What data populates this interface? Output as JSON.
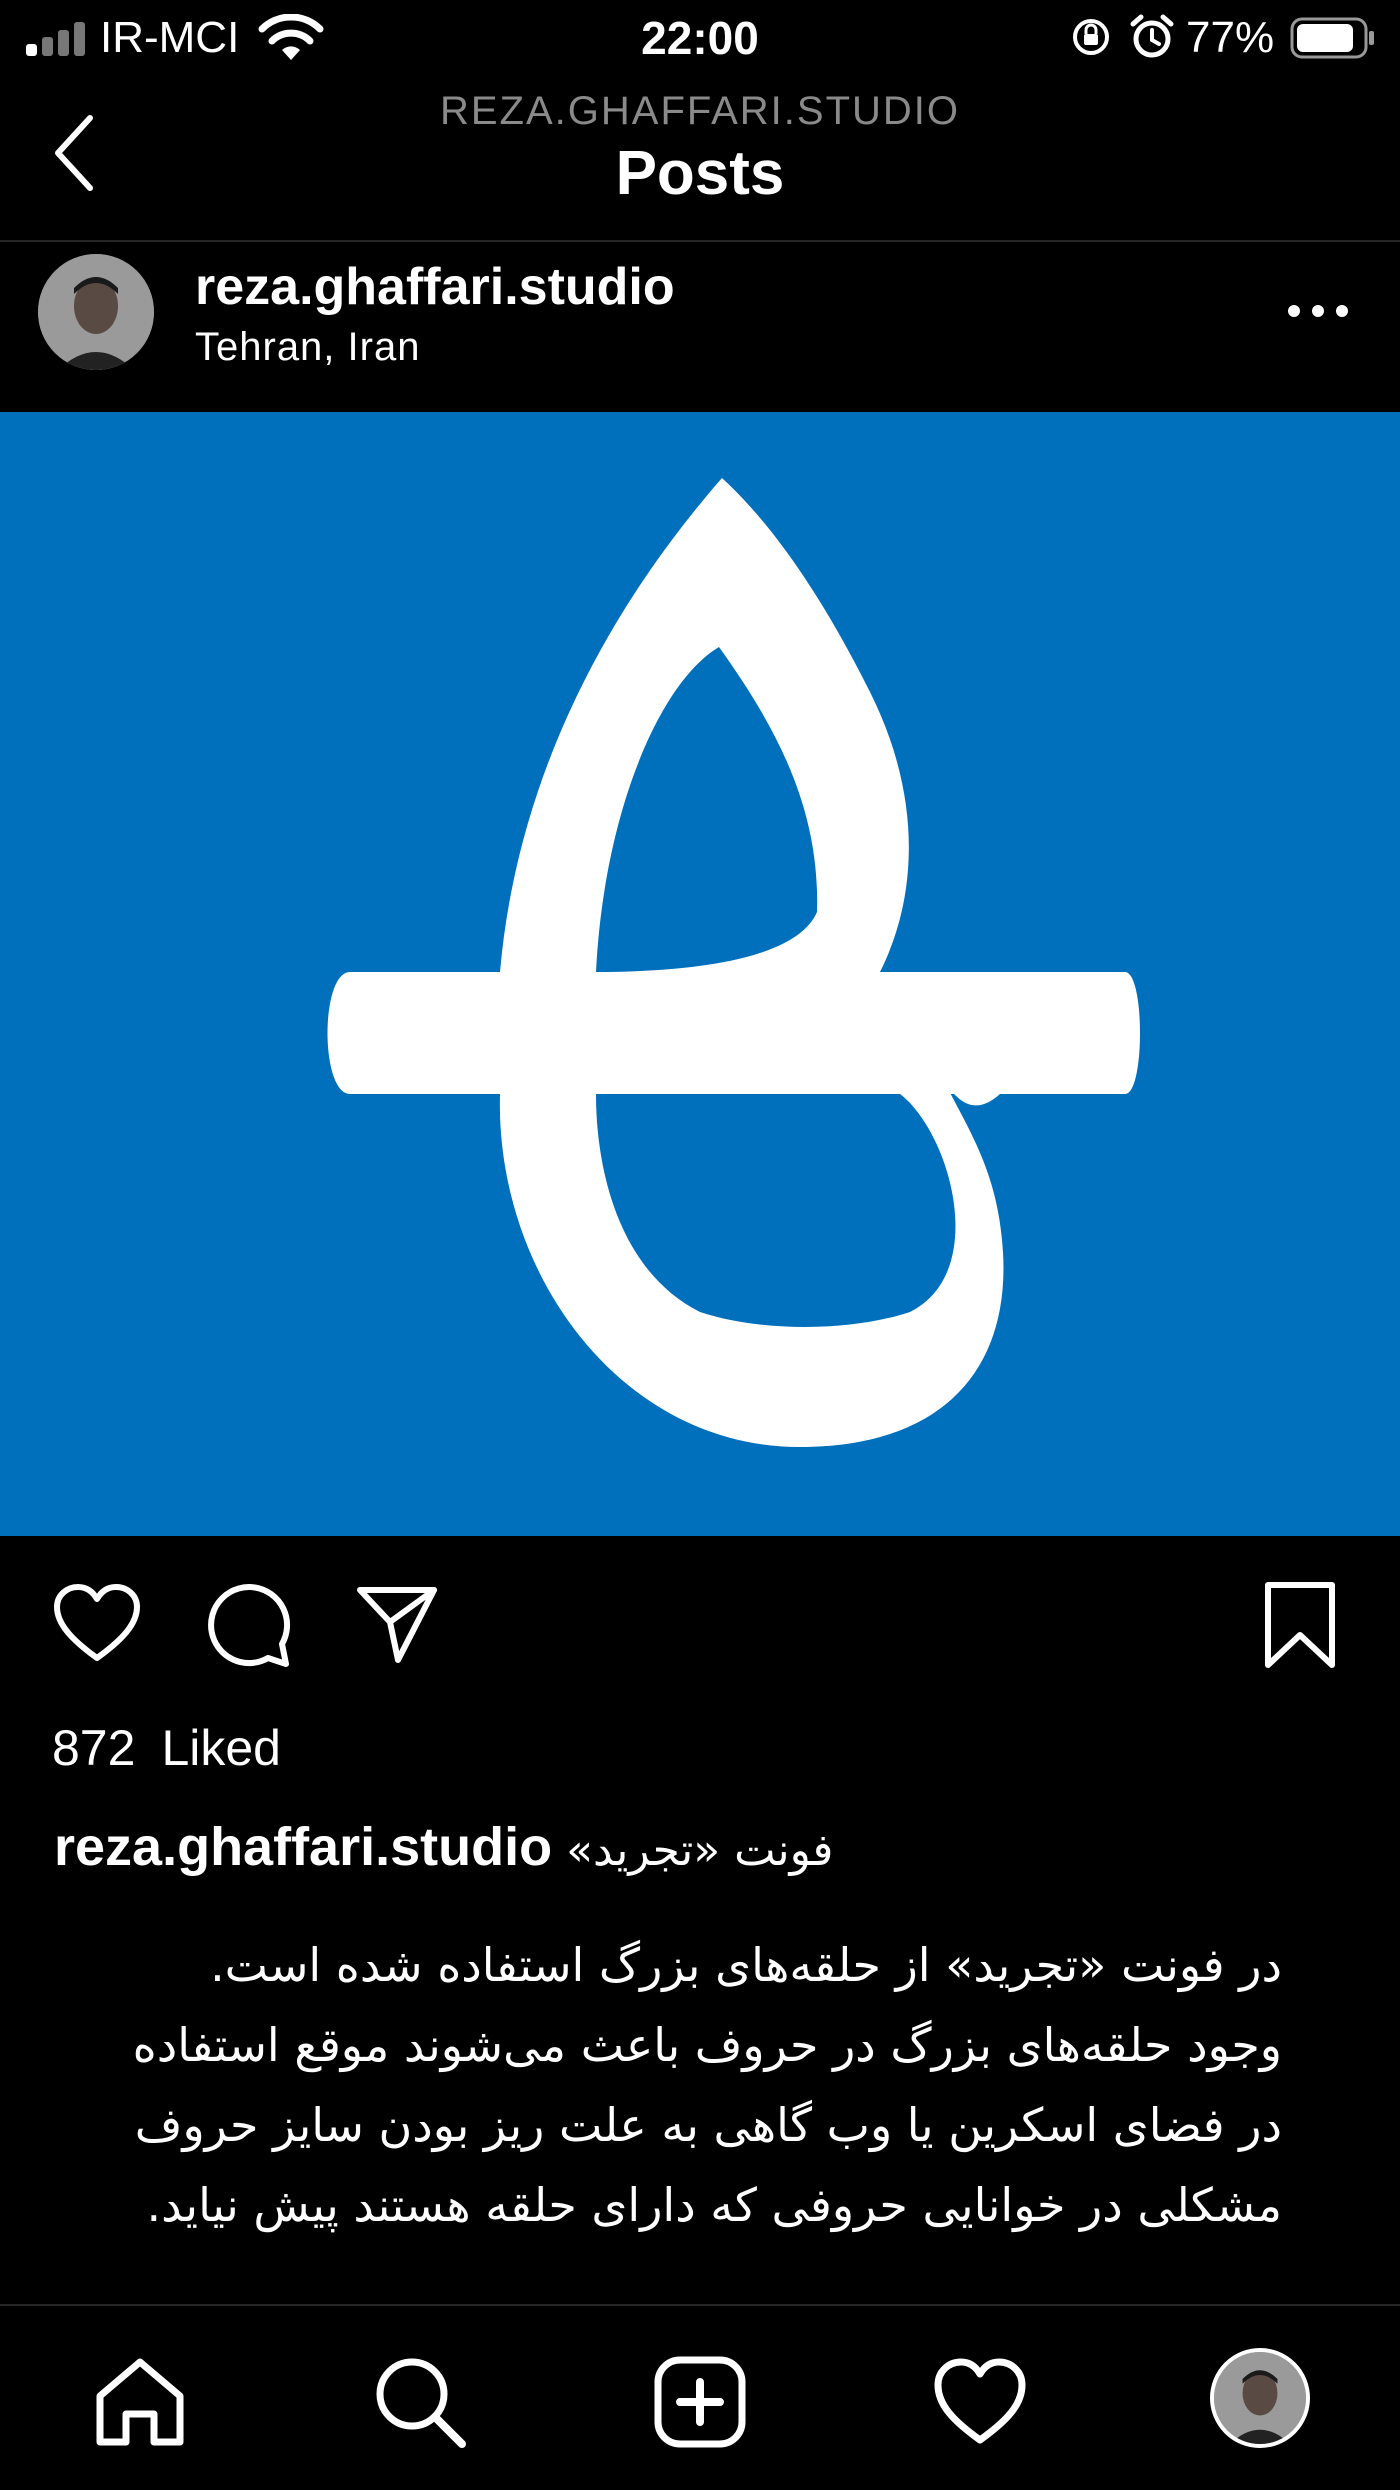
{
  "status_bar": {
    "carrier": "IR-MCI",
    "time": "22:00",
    "battery": "77%",
    "battery_level": 0.77,
    "icons": [
      "signal-icon",
      "wifi-icon",
      "orientation-lock-icon",
      "alarm-icon",
      "battery-icon"
    ]
  },
  "header": {
    "account": "REZA.GHAFFARI.STUDIO",
    "title": "Posts",
    "back_icon": "chevron-left-icon"
  },
  "post": {
    "username": "reza.ghaffari.studio",
    "location": "Tehran, Iran",
    "more_icon": "more-horizontal-icon",
    "image": {
      "background": "#0070bd",
      "glyph_color": "#ffffff",
      "description_icon": "letter-glyph"
    },
    "actions": [
      "heart-icon",
      "comment-icon",
      "send-icon",
      "bookmark-icon"
    ],
    "likes_count": "872",
    "likes_label": "Liked",
    "caption_title": "فونت «تجرید»",
    "caption_lines": [
      "در فونت «تجرید» از حلقه‌های بزرگ استفاده شده است.",
      "وجود حلقه‌های بزرگ در حروف باعث می‌شوند موقع استفاده",
      "در فضای اسکرین یا وب گاهی به علت ریز بودن سایز حروف",
      "مشکلی در خوانایی حروفی که دارای حلقه هستند پیش نیاید."
    ]
  },
  "tab_bar": {
    "tabs": [
      "home-icon",
      "search-icon",
      "create-icon",
      "activity-heart-icon",
      "profile-avatar"
    ]
  }
}
